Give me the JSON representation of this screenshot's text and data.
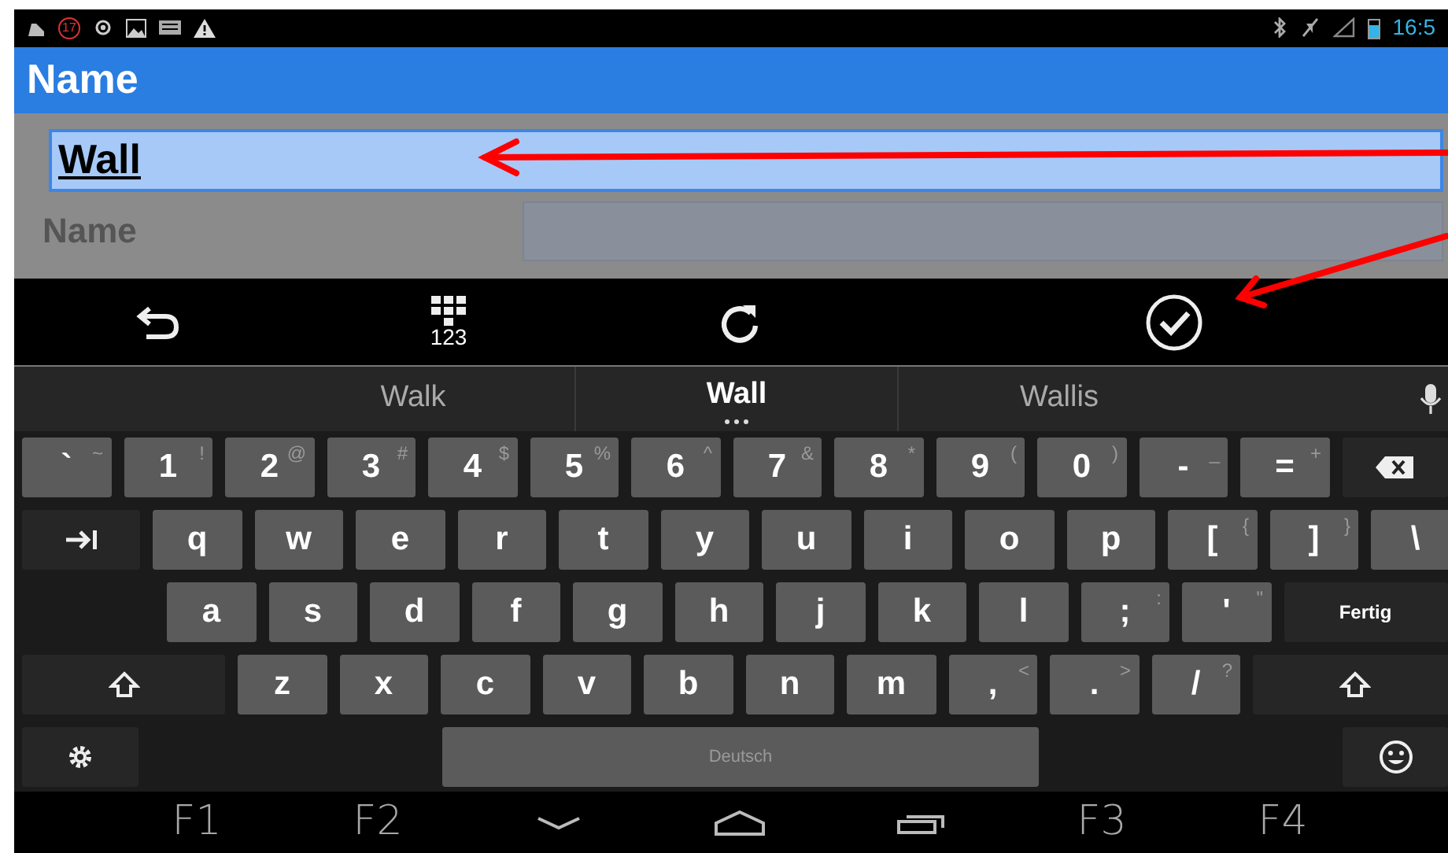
{
  "status_bar": {
    "time": "16:5",
    "notification_badge": "17"
  },
  "title_bar": {
    "title": "Name"
  },
  "form": {
    "fields": [
      {
        "value": "Wall",
        "selected": true
      },
      {
        "label": "Name"
      }
    ]
  },
  "edit_toolbar": [
    {
      "kind": "undo"
    },
    {
      "kind": "numpad",
      "label": "123"
    },
    {
      "kind": "reload"
    },
    {
      "kind": "done"
    }
  ],
  "keyboard": {
    "suggestions": [
      {
        "text": "Walk",
        "selected": false
      },
      {
        "text": "Wall",
        "selected": true
      },
      {
        "text": "Wallis",
        "selected": false
      }
    ],
    "rows": [
      {
        "keys": [
          {
            "kind": "key",
            "label": "`",
            "hint": "~"
          },
          {
            "kind": "key",
            "label": "1",
            "hint": "!"
          },
          {
            "kind": "key",
            "label": "2",
            "hint": "@"
          },
          {
            "kind": "key",
            "label": "3",
            "hint": "#"
          },
          {
            "kind": "key",
            "label": "4",
            "hint": "$"
          },
          {
            "kind": "key",
            "label": "5",
            "hint": "%"
          },
          {
            "kind": "key",
            "label": "6",
            "hint": "^"
          },
          {
            "kind": "key",
            "label": "7",
            "hint": "&"
          },
          {
            "kind": "key",
            "label": "8",
            "hint": "*"
          },
          {
            "kind": "key",
            "label": "9",
            "hint": "("
          },
          {
            "kind": "key",
            "label": "0",
            "hint": ")"
          },
          {
            "kind": "key",
            "label": "-",
            "hint": "_"
          },
          {
            "kind": "key",
            "label": "=",
            "hint": "+"
          },
          {
            "kind": "backspace"
          }
        ]
      },
      {
        "keys": [
          {
            "kind": "tab"
          },
          {
            "kind": "key",
            "label": "q"
          },
          {
            "kind": "key",
            "label": "w"
          },
          {
            "kind": "key",
            "label": "e"
          },
          {
            "kind": "key",
            "label": "r"
          },
          {
            "kind": "key",
            "label": "t"
          },
          {
            "kind": "key",
            "label": "y"
          },
          {
            "kind": "key",
            "label": "u"
          },
          {
            "kind": "key",
            "label": "i"
          },
          {
            "kind": "key",
            "label": "o"
          },
          {
            "kind": "key",
            "label": "p"
          },
          {
            "kind": "key",
            "label": "[",
            "hint": "{"
          },
          {
            "kind": "key",
            "label": "]",
            "hint": "}"
          },
          {
            "kind": "key",
            "label": "\\"
          }
        ]
      },
      {
        "keys": [
          {
            "kind": "key",
            "label": "a"
          },
          {
            "kind": "key",
            "label": "s"
          },
          {
            "kind": "key",
            "label": "d"
          },
          {
            "kind": "key",
            "label": "f"
          },
          {
            "kind": "key",
            "label": "g"
          },
          {
            "kind": "key",
            "label": "h"
          },
          {
            "kind": "key",
            "label": "j"
          },
          {
            "kind": "key",
            "label": "k"
          },
          {
            "kind": "key",
            "label": "l"
          },
          {
            "kind": "key",
            "label": ";",
            "hint": ":"
          },
          {
            "kind": "key",
            "label": "'",
            "hint": "\""
          },
          {
            "kind": "enter",
            "label": "Fertig"
          }
        ]
      },
      {
        "keys": [
          {
            "kind": "shift"
          },
          {
            "kind": "key",
            "label": "z"
          },
          {
            "kind": "key",
            "label": "x"
          },
          {
            "kind": "key",
            "label": "c"
          },
          {
            "kind": "key",
            "label": "v"
          },
          {
            "kind": "key",
            "label": "b"
          },
          {
            "kind": "key",
            "label": "n"
          },
          {
            "kind": "key",
            "label": "m"
          },
          {
            "kind": "key",
            "label": ",",
            "hint": "<"
          },
          {
            "kind": "key",
            "label": ".",
            "hint": ">"
          },
          {
            "kind": "key",
            "label": "/",
            "hint": "?"
          },
          {
            "kind": "shift"
          }
        ]
      },
      {
        "keys": [
          {
            "kind": "settings"
          },
          {
            "kind": "space",
            "label": "Deutsch"
          },
          {
            "kind": "emoji"
          }
        ]
      }
    ]
  },
  "nav_bar": [
    {
      "kind": "label",
      "label": "F1"
    },
    {
      "kind": "label",
      "label": "F2"
    },
    {
      "kind": "back"
    },
    {
      "kind": "home"
    },
    {
      "kind": "recents"
    },
    {
      "kind": "label",
      "label": "F3"
    },
    {
      "kind": "label",
      "label": "F4"
    }
  ]
}
